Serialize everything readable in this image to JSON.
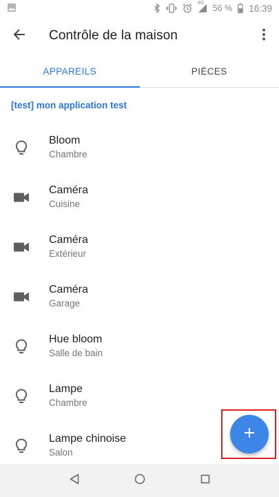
{
  "status_bar": {
    "battery_percent": "56 %",
    "time": "16:39",
    "network_type": "4G",
    "icons": [
      "gallery-icon",
      "bluetooth-icon",
      "vibrate-icon",
      "alarm-icon",
      "signal-icon",
      "battery-icon"
    ]
  },
  "app_bar": {
    "title": "Contrôle de la maison",
    "back_icon": "arrow-back-icon",
    "overflow_icon": "more-vert-icon"
  },
  "tabs": [
    {
      "label": "APPAREILS",
      "active": true
    },
    {
      "label": "PIÈCES",
      "active": false
    }
  ],
  "section": {
    "header": "[test] mon application test"
  },
  "devices": [
    {
      "name": "Bloom",
      "room": "Chambre",
      "icon": "lightbulb-icon"
    },
    {
      "name": "Caméra",
      "room": "Cuisine",
      "icon": "videocam-icon"
    },
    {
      "name": "Caméra",
      "room": "Extérieur",
      "icon": "videocam-icon"
    },
    {
      "name": "Caméra",
      "room": "Garage",
      "icon": "videocam-icon"
    },
    {
      "name": "Hue bloom",
      "room": "Salle de bain",
      "icon": "lightbulb-icon"
    },
    {
      "name": "Lampe",
      "room": "Chambre",
      "icon": "lightbulb-icon"
    },
    {
      "name": "Lampe chinoise",
      "room": "Salon",
      "icon": "lightbulb-icon"
    }
  ],
  "fab": {
    "icon": "add-icon"
  },
  "nav_bar": {
    "icons": [
      "back-triangle-icon",
      "home-circle-icon",
      "recents-square-icon"
    ]
  },
  "colors": {
    "accent": "#2a75d9",
    "fab": "#3b86e6",
    "highlight": "#e02020"
  }
}
